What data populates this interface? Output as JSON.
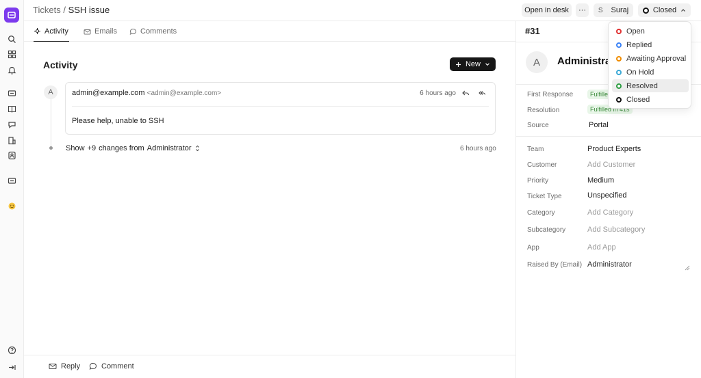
{
  "breadcrumb": {
    "root": "Tickets",
    "sep": "/",
    "current": "SSH issue"
  },
  "topbar": {
    "open_desk": "Open in desk",
    "more": "···",
    "user_initial": "S",
    "user_name": "Suraj",
    "status": "Closed"
  },
  "tabs": [
    {
      "label": "Activity"
    },
    {
      "label": "Emails"
    },
    {
      "label": "Comments"
    }
  ],
  "activity": {
    "title": "Activity",
    "new_button": "New",
    "avatar": "A",
    "email": {
      "from": "admin@example.com",
      "from_email": "<admin@example.com>",
      "time": "6 hours ago",
      "body": "Please help, unable to SSH"
    },
    "changes": {
      "show": "Show",
      "count": "+9",
      "text": "changes from",
      "who": "Administrator",
      "time": "6 hours ago"
    }
  },
  "bottom": {
    "reply": "Reply",
    "comment": "Comment"
  },
  "sidebar": {
    "ticket_id": "#31",
    "avatar": "A",
    "name": "Administrator",
    "first_response_label": "First Response",
    "first_response_value": "Fulfilled in 41s",
    "resolution_label": "Resolution",
    "resolution_value": "Fulfilled in 41s",
    "source_label": "Source",
    "source_value": "Portal",
    "fields": [
      {
        "label": "Team",
        "value": "Product Experts",
        "placeholder": false
      },
      {
        "label": "Customer",
        "value": "Add Customer",
        "placeholder": true
      },
      {
        "label": "Priority",
        "value": "Medium",
        "placeholder": false
      },
      {
        "label": "Ticket Type",
        "value": "Unspecified",
        "placeholder": false
      },
      {
        "label": "Category",
        "value": "Add Category",
        "placeholder": true
      },
      {
        "label": "Subcategory",
        "value": "Add Subcategory",
        "placeholder": true
      },
      {
        "label": "App",
        "value": "Add App",
        "placeholder": true
      },
      {
        "label": "Raised By (Email)",
        "value": "Administrator",
        "placeholder": false
      }
    ]
  },
  "status_menu": {
    "items": [
      {
        "label": "Open",
        "color": "#e03131"
      },
      {
        "label": "Replied",
        "color": "#3b82f6"
      },
      {
        "label": "Awaiting Approval",
        "color": "#f08c00"
      },
      {
        "label": "On Hold",
        "color": "#3ba9d6"
      },
      {
        "label": "Resolved",
        "color": "#2f9e44"
      },
      {
        "label": "Closed",
        "color": "#111111"
      }
    ],
    "highlighted": "Resolved"
  },
  "colors": {
    "brand": "#7c3aed",
    "primary_button": "#171717",
    "badge_green": "#3a8a3a"
  }
}
